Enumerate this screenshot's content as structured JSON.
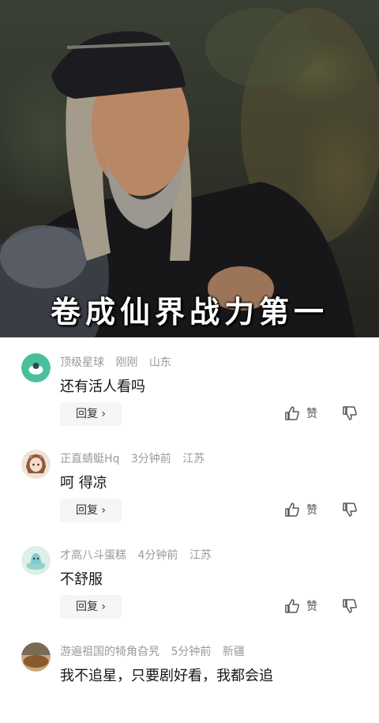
{
  "video": {
    "subtitle": "卷成仙界战力第一"
  },
  "comments": [
    {
      "username": "顶级星球",
      "time": "刚刚",
      "location": "山东",
      "text": "还有活人看吗",
      "reply_label": "回复",
      "like_label": "赞",
      "avatar_color": "#4bbf9c"
    },
    {
      "username": "正直蜻蜓Hq",
      "time": "3分钟前",
      "location": "江苏",
      "text": "呵 得凉",
      "reply_label": "回复",
      "like_label": "赞",
      "avatar_color": "#e9d7c7"
    },
    {
      "username": "才高八斗蛋糕",
      "time": "4分钟前",
      "location": "江苏",
      "text": "不舒服",
      "reply_label": "回复",
      "like_label": "赞",
      "avatar_color": "#bfe6e0"
    },
    {
      "username": "游遍祖国的犄角旮旯",
      "time": "5分钟前",
      "location": "新疆",
      "text": "我不追星，只要剧好看，我都会追",
      "avatar_color": "#8a6a4a"
    }
  ],
  "icons": {
    "reply_chevron": "chevron-right-icon",
    "like": "thumbs-up-icon",
    "dislike": "thumbs-down-icon"
  }
}
